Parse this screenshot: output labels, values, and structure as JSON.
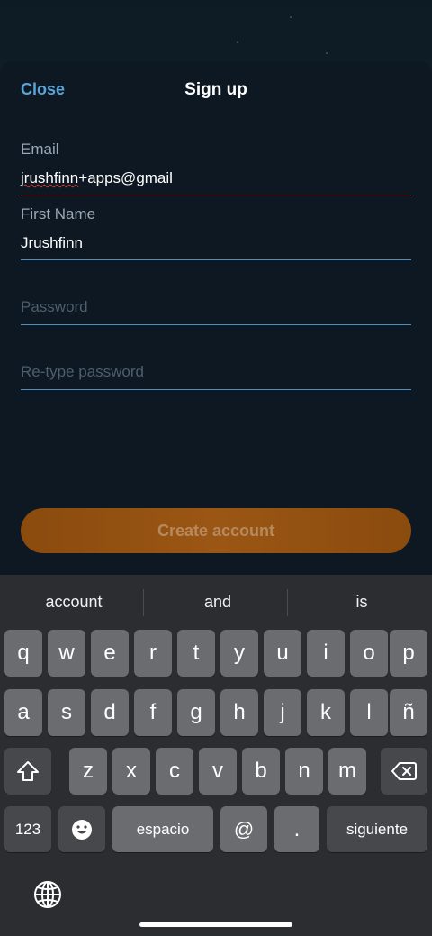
{
  "header": {
    "close_label": "Close",
    "title": "Sign up"
  },
  "form": {
    "email": {
      "label": "Email",
      "value_word": "jrushfinn",
      "value_rest": "+apps@gmail"
    },
    "first_name": {
      "label": "First Name",
      "value": "Jrushfinn"
    },
    "password": {
      "placeholder": "Password"
    },
    "retype_password": {
      "placeholder": "Re-type password"
    },
    "submit_label": "Create account"
  },
  "colors": {
    "accent": "#5aa5d8",
    "error_line": "#c0505a",
    "field_line": "#4a8fc0",
    "button": "#9b5614"
  },
  "keyboard": {
    "suggestions": [
      "account",
      "and",
      "is"
    ],
    "row1": [
      "q",
      "w",
      "e",
      "r",
      "t",
      "y",
      "u",
      "i",
      "o",
      "p"
    ],
    "row2": [
      "a",
      "s",
      "d",
      "f",
      "g",
      "h",
      "j",
      "k",
      "l",
      "ñ"
    ],
    "row3": [
      "z",
      "x",
      "c",
      "v",
      "b",
      "n",
      "m"
    ],
    "numbers_label": "123",
    "space_label": "espacio",
    "at_label": "@",
    "dot_label": ".",
    "return_label": "siguiente",
    "icons": {
      "shift": "shift-icon",
      "delete": "backspace-icon",
      "emoji": "emoji-icon",
      "globe": "globe-icon"
    }
  }
}
